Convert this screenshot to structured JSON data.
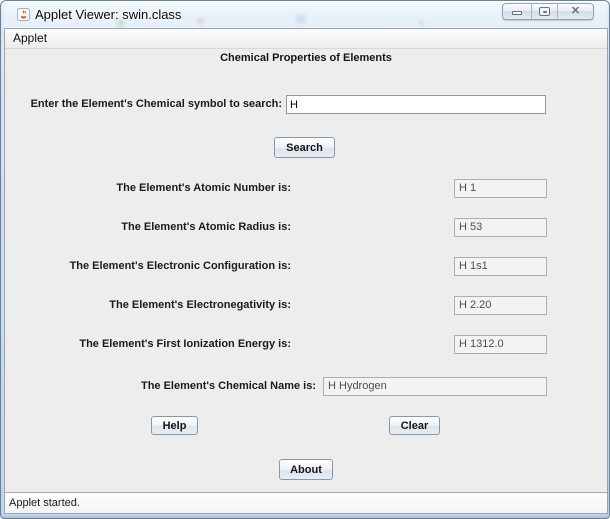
{
  "window": {
    "title": "Applet Viewer: swin.class"
  },
  "icons": {
    "app": "java-applet-icon",
    "minimize": "minimize-bar",
    "maximize": "restore-box",
    "close": "✕"
  },
  "menu_bar": {
    "items": [
      {
        "label": "Applet"
      }
    ]
  },
  "applet": {
    "heading": "Chemical Properties of Elements",
    "search_label": "Enter the Element's Chemical symbol to search:",
    "search_value": "H",
    "search_button": "Search",
    "results": [
      {
        "label": "The Element's Atomic Number is:",
        "value": "H 1"
      },
      {
        "label": "The Element's Atomic Radius is:",
        "value": "H 53"
      },
      {
        "label": "The Element's Electronic Configuration is:",
        "value": "H 1s1"
      },
      {
        "label": "The Element's Electronegativity is:",
        "value": "H 2.20"
      },
      {
        "label": "The Element's First Ionization Energy is:",
        "value": "H 1312.0"
      },
      {
        "label": "The Element's Chemical Name is:",
        "value": "H Hydrogen"
      }
    ],
    "help_button": "Help",
    "clear_button": "Clear",
    "about_button": "About"
  },
  "status_bar": {
    "text": "Applet started."
  },
  "colors": {
    "frame": "#d9e7f3",
    "panel": "#ededed",
    "field_border": "#8b97a3",
    "result_field_bg": "#f3f3f3",
    "button_border": "#8599ad"
  }
}
